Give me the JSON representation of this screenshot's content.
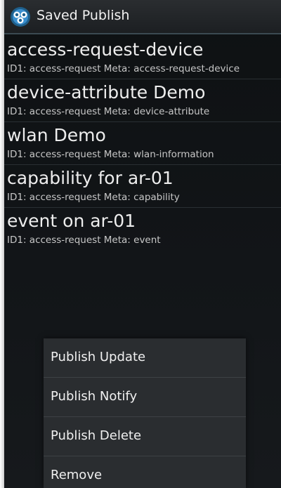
{
  "app": {
    "title": "Saved Publish",
    "icon": "app-logo-icon"
  },
  "list": {
    "items": [
      {
        "title": "access-request-device",
        "subtitle": "ID1: access-request Meta: access-request-device"
      },
      {
        "title": "device-attribute Demo",
        "subtitle": "ID1: access-request Meta: device-attribute"
      },
      {
        "title": "wlan Demo",
        "subtitle": "ID1: access-request Meta: wlan-information"
      },
      {
        "title": "capability for ar-01",
        "subtitle": "ID1: access-request Meta: capability"
      },
      {
        "title": "event on ar-01",
        "subtitle": "ID1: access-request Meta: event"
      }
    ]
  },
  "context_menu": {
    "items": [
      {
        "label": "Publish Update"
      },
      {
        "label": "Publish Notify"
      },
      {
        "label": "Publish Delete"
      },
      {
        "label": "Remove"
      }
    ]
  },
  "colors": {
    "background": "#121518",
    "action_bar": "#1c1f22",
    "menu": "#2a2d30",
    "text": "#ededed"
  }
}
